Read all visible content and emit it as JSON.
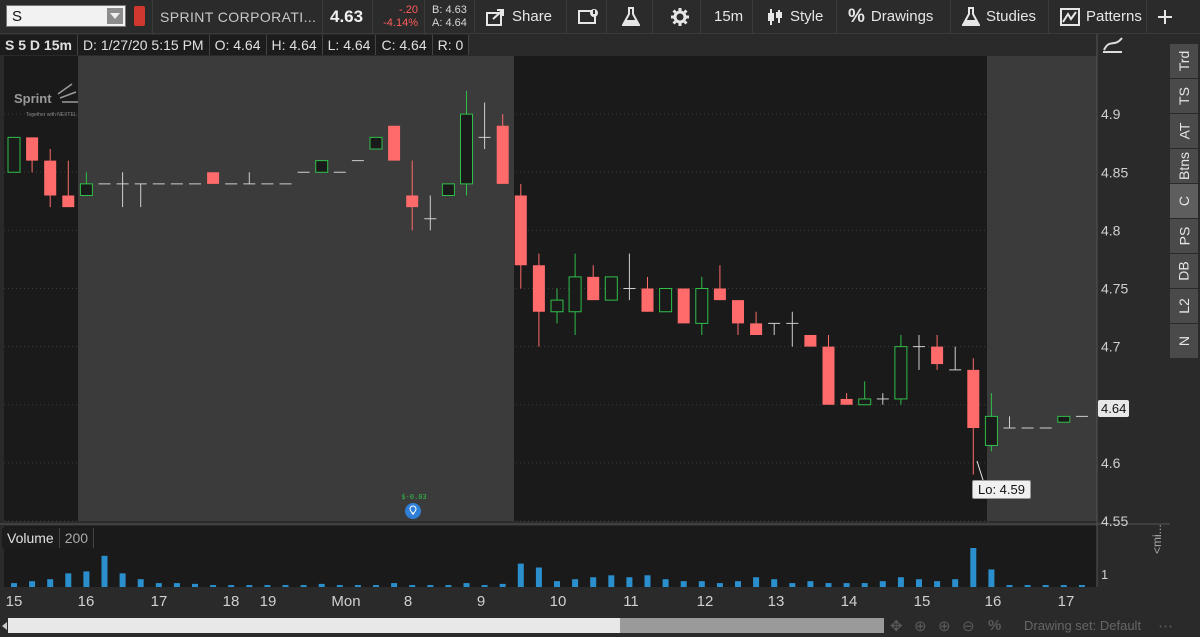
{
  "toolbar": {
    "symbol": "S",
    "company": "SPRINT CORPORATI...",
    "last_price": "4.63",
    "change": "-.20",
    "change_pct": "-4.14%",
    "bid": "B: 4.63",
    "ask": "A: 4.64",
    "share_label": "Share",
    "timeframe": "15m",
    "style_label": "Style",
    "drawings_label": "Drawings",
    "studies_label": "Studies",
    "patterns_label": "Patterns"
  },
  "info_bar": {
    "symbol": "S 5 D 15m",
    "date": "D: 1/27/20 5:15 PM",
    "open": "O: 4.64",
    "high": "H: 4.64",
    "low": "L: 4.64",
    "close": "C: 4.64",
    "range": "R: 0"
  },
  "volume_panel": {
    "label": "Volume",
    "value": "200"
  },
  "side_tabs": [
    "Trd",
    "TS",
    "AT",
    "Btns",
    "C",
    "PS",
    "DB",
    "L2",
    "N"
  ],
  "active_side_tab": "C",
  "callouts": {
    "low": "Lo: 4.59",
    "current_price": "4.64",
    "event": "$-0.03"
  },
  "watermark": {
    "brand": "Sprint",
    "tagline": "Together with NEXTEL"
  },
  "bottom_bar": {
    "drawing_set": "Drawing set: Default",
    "volume_axis_label": "<mi..."
  },
  "colors": {
    "up": "#2fbf4a",
    "down": "#ff6b6b",
    "flat": "#cfcfcf",
    "volume": "#2a8fcc",
    "session_shade": "#3b3b3b",
    "plot_bg": "#1a1a1a"
  },
  "chart_data": {
    "type": "candlestick",
    "y_ticks": [
      "4.9",
      "4.85",
      "4.8",
      "4.75",
      "4.7",
      "4.65",
      "4.6",
      "4.55"
    ],
    "ylim": [
      4.55,
      4.95
    ],
    "volume_ticks": [
      "1"
    ],
    "x_tick_labels": [
      "15",
      "16",
      "17",
      "18",
      "19",
      "Mon",
      "8",
      "9",
      "10",
      "11",
      "12",
      "13",
      "14",
      "15",
      "16",
      "17"
    ],
    "candles": [
      {
        "o": 4.85,
        "h": 4.88,
        "l": 4.85,
        "c": 4.88
      },
      {
        "o": 4.88,
        "h": 4.88,
        "l": 4.85,
        "c": 4.86
      },
      {
        "o": 4.86,
        "h": 4.87,
        "l": 4.82,
        "c": 4.83
      },
      {
        "o": 4.83,
        "h": 4.86,
        "l": 4.82,
        "c": 4.82
      },
      {
        "o": 4.83,
        "h": 4.85,
        "l": 4.83,
        "c": 4.84
      },
      {
        "o": 4.84,
        "h": 4.84,
        "l": 4.84,
        "c": 4.84
      },
      {
        "o": 4.84,
        "h": 4.85,
        "l": 4.82,
        "c": 4.84
      },
      {
        "o": 4.84,
        "h": 4.84,
        "l": 4.82,
        "c": 4.84
      },
      {
        "o": 4.84,
        "h": 4.84,
        "l": 4.84,
        "c": 4.84
      },
      {
        "o": 4.84,
        "h": 4.84,
        "l": 4.84,
        "c": 4.84
      },
      {
        "o": 4.84,
        "h": 4.84,
        "l": 4.84,
        "c": 4.84
      },
      {
        "o": 4.85,
        "h": 4.85,
        "l": 4.84,
        "c": 4.84
      },
      {
        "o": 4.84,
        "h": 4.84,
        "l": 4.84,
        "c": 4.84
      },
      {
        "o": 4.84,
        "h": 4.85,
        "l": 4.84,
        "c": 4.84
      },
      {
        "o": 4.84,
        "h": 4.84,
        "l": 4.84,
        "c": 4.84
      },
      {
        "o": 4.84,
        "h": 4.84,
        "l": 4.84,
        "c": 4.84
      },
      {
        "o": 4.85,
        "h": 4.85,
        "l": 4.85,
        "c": 4.85
      },
      {
        "o": 4.85,
        "h": 4.86,
        "l": 4.85,
        "c": 4.86
      },
      {
        "o": 4.85,
        "h": 4.85,
        "l": 4.85,
        "c": 4.85
      },
      {
        "o": 4.86,
        "h": 4.86,
        "l": 4.86,
        "c": 4.86
      },
      {
        "o": 4.87,
        "h": 4.88,
        "l": 4.87,
        "c": 4.88
      },
      {
        "o": 4.89,
        "h": 4.89,
        "l": 4.86,
        "c": 4.86
      },
      {
        "o": 4.83,
        "h": 4.86,
        "l": 4.8,
        "c": 4.82
      },
      {
        "o": 4.81,
        "h": 4.83,
        "l": 4.8,
        "c": 4.81
      },
      {
        "o": 4.83,
        "h": 4.84,
        "l": 4.83,
        "c": 4.84
      },
      {
        "o": 4.84,
        "h": 4.92,
        "l": 4.83,
        "c": 4.9
      },
      {
        "o": 4.88,
        "h": 4.91,
        "l": 4.87,
        "c": 4.88
      },
      {
        "o": 4.89,
        "h": 4.9,
        "l": 4.84,
        "c": 4.84
      },
      {
        "o": 4.83,
        "h": 4.84,
        "l": 4.75,
        "c": 4.77
      },
      {
        "o": 4.77,
        "h": 4.78,
        "l": 4.7,
        "c": 4.73
      },
      {
        "o": 4.73,
        "h": 4.75,
        "l": 4.72,
        "c": 4.74
      },
      {
        "o": 4.73,
        "h": 4.78,
        "l": 4.71,
        "c": 4.76
      },
      {
        "o": 4.76,
        "h": 4.77,
        "l": 4.74,
        "c": 4.74
      },
      {
        "o": 4.74,
        "h": 4.76,
        "l": 4.74,
        "c": 4.76
      },
      {
        "o": 4.75,
        "h": 4.78,
        "l": 4.74,
        "c": 4.75
      },
      {
        "o": 4.75,
        "h": 4.76,
        "l": 4.73,
        "c": 4.73
      },
      {
        "o": 4.73,
        "h": 4.75,
        "l": 4.73,
        "c": 4.75
      },
      {
        "o": 4.75,
        "h": 4.75,
        "l": 4.72,
        "c": 4.72
      },
      {
        "o": 4.72,
        "h": 4.76,
        "l": 4.71,
        "c": 4.75
      },
      {
        "o": 4.75,
        "h": 4.77,
        "l": 4.74,
        "c": 4.74
      },
      {
        "o": 4.74,
        "h": 4.74,
        "l": 4.71,
        "c": 4.72
      },
      {
        "o": 4.72,
        "h": 4.73,
        "l": 4.71,
        "c": 4.71
      },
      {
        "o": 4.72,
        "h": 4.72,
        "l": 4.71,
        "c": 4.72
      },
      {
        "o": 4.72,
        "h": 4.73,
        "l": 4.7,
        "c": 4.72
      },
      {
        "o": 4.71,
        "h": 4.71,
        "l": 4.7,
        "c": 4.7
      },
      {
        "o": 4.7,
        "h": 4.71,
        "l": 4.65,
        "c": 4.65
      },
      {
        "o": 4.655,
        "h": 4.66,
        "l": 4.65,
        "c": 4.65
      },
      {
        "o": 4.65,
        "h": 4.67,
        "l": 4.65,
        "c": 4.655
      },
      {
        "o": 4.655,
        "h": 4.66,
        "l": 4.65,
        "c": 4.655
      },
      {
        "o": 4.655,
        "h": 4.71,
        "l": 4.65,
        "c": 4.7
      },
      {
        "o": 4.7,
        "h": 4.71,
        "l": 4.68,
        "c": 4.7
      },
      {
        "o": 4.7,
        "h": 4.71,
        "l": 4.68,
        "c": 4.685
      },
      {
        "o": 4.68,
        "h": 4.7,
        "l": 4.68,
        "c": 4.68
      },
      {
        "o": 4.68,
        "h": 4.69,
        "l": 4.59,
        "c": 4.63
      },
      {
        "o": 4.615,
        "h": 4.66,
        "l": 4.61,
        "c": 4.64
      },
      {
        "o": 4.63,
        "h": 4.64,
        "l": 4.63,
        "c": 4.63
      },
      {
        "o": 4.63,
        "h": 4.63,
        "l": 4.63,
        "c": 4.63
      },
      {
        "o": 4.63,
        "h": 4.63,
        "l": 4.63,
        "c": 4.63
      },
      {
        "o": 4.635,
        "h": 4.64,
        "l": 4.635,
        "c": 4.64
      },
      {
        "o": 4.64,
        "h": 4.64,
        "l": 4.64,
        "c": 4.64
      }
    ],
    "volumes": [
      0.1,
      0.15,
      0.2,
      0.35,
      0.4,
      0.8,
      0.35,
      0.2,
      0.1,
      0.1,
      0.08,
      0.05,
      0.05,
      0.05,
      0.05,
      0.05,
      0.05,
      0.08,
      0.05,
      0.05,
      0.05,
      0.1,
      0.05,
      0.05,
      0.05,
      0.1,
      0.05,
      0.08,
      0.6,
      0.5,
      0.15,
      0.2,
      0.25,
      0.3,
      0.25,
      0.3,
      0.2,
      0.15,
      0.15,
      0.1,
      0.15,
      0.25,
      0.2,
      0.1,
      0.15,
      0.1,
      0.1,
      0.1,
      0.15,
      0.25,
      0.2,
      0.15,
      0.2,
      1.0,
      0.45,
      0.05,
      0.05,
      0.05,
      0.05,
      0.05
    ],
    "grid": true
  }
}
